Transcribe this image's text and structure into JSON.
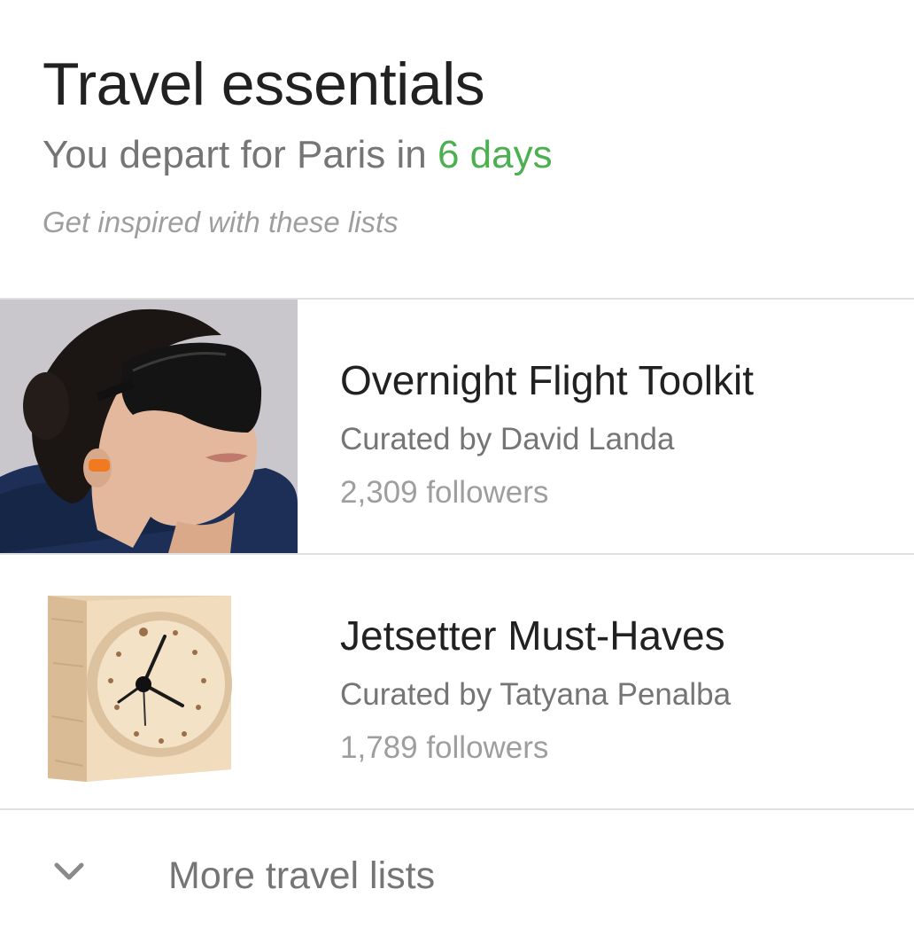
{
  "card": {
    "title": "Travel essentials",
    "subtitle_prefix": "You depart for Paris in ",
    "subtitle_highlight": "6 days",
    "hint": "Get inspired with these lists",
    "accent_color": "#4caf50"
  },
  "lists": [
    {
      "title": "Overnight Flight Toolkit",
      "curator": "Curated by David Landa",
      "followers_count": "2,309",
      "followers_label": "followers",
      "image": "sleeping-mask-photo"
    },
    {
      "title": "Jetsetter Must-Haves",
      "curator": "Curated by Tatyana Penalba",
      "followers_count": "1,789",
      "followers_label": "followers",
      "image": "wooden-clock-photo"
    }
  ],
  "more": {
    "label": "More travel lists",
    "icon": "chevron-down-icon"
  }
}
